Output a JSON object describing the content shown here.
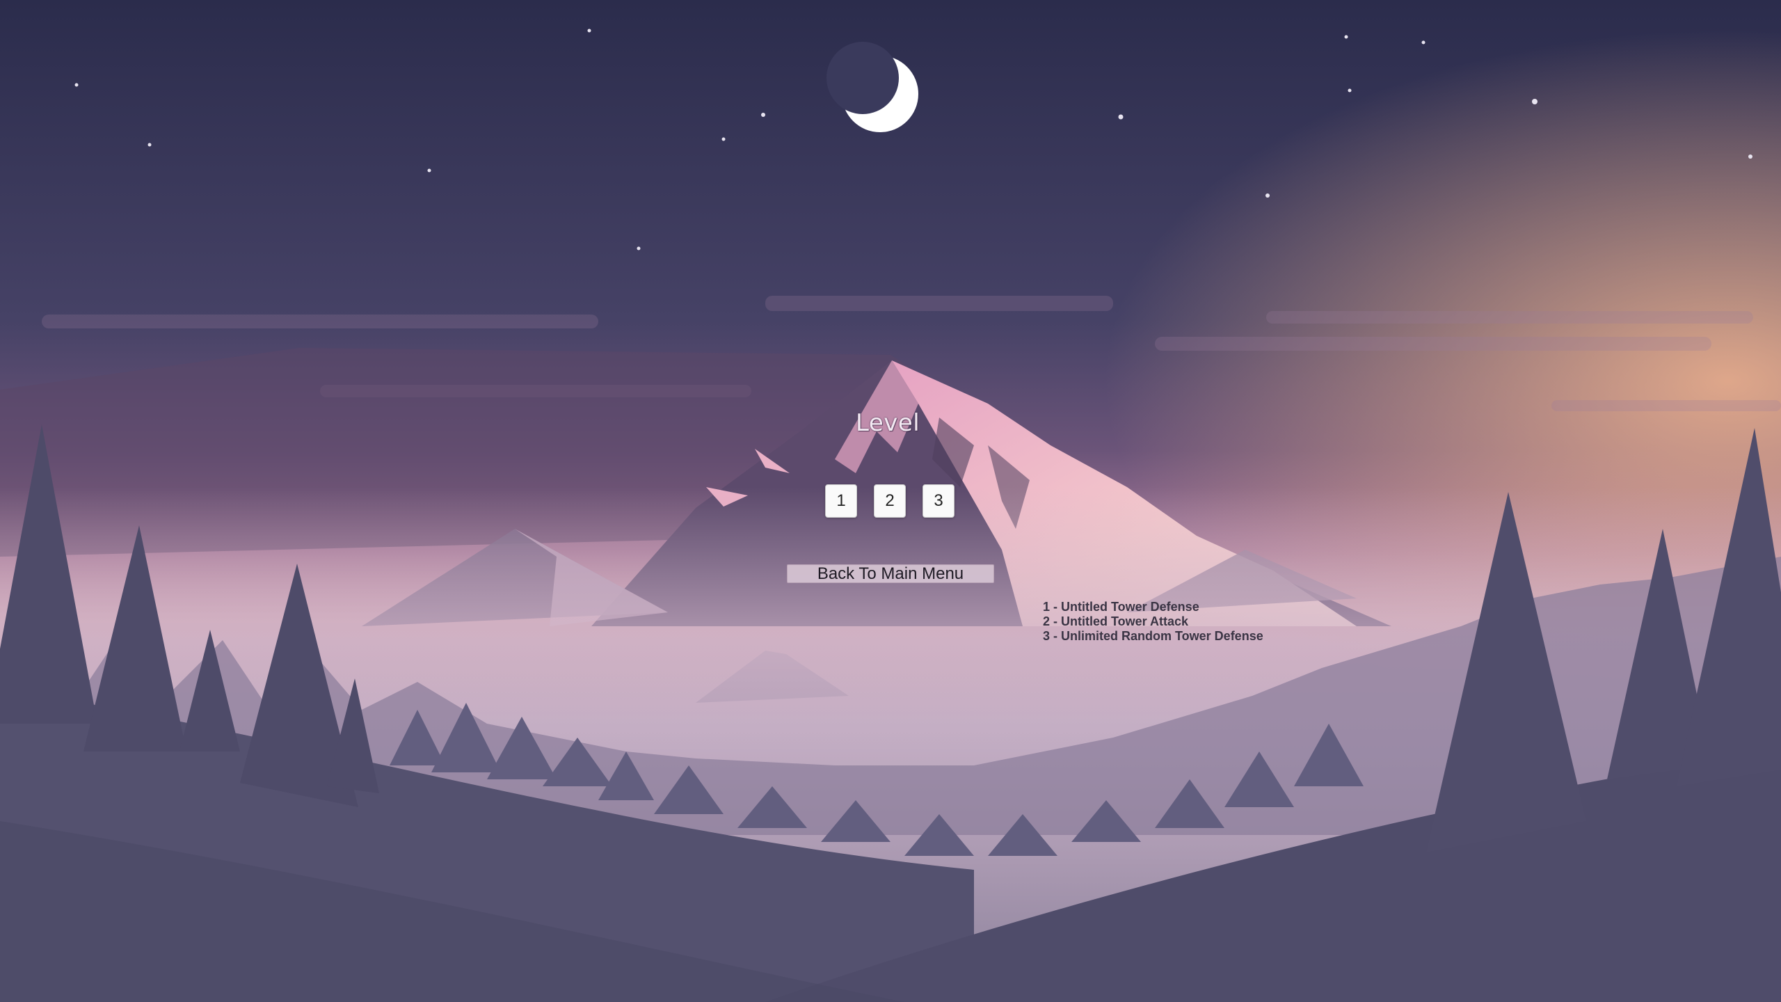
{
  "menu": {
    "title": "Level",
    "levels": [
      {
        "label": "1"
      },
      {
        "label": "2"
      },
      {
        "label": "3"
      }
    ],
    "back_label": "Back To Main Menu",
    "legend": [
      "1 - Untitled Tower Defense",
      "2 - Untitled Tower Attack",
      "3 - Unlimited Random Tower Defense"
    ]
  },
  "background": {
    "scene": "night mountain landscape with crescent moon, stars and pine forest",
    "sky_top": "#2b2c4c",
    "sky_horizon": "#f0b49a",
    "mist": "#c9aec3",
    "hills": "#565372"
  }
}
